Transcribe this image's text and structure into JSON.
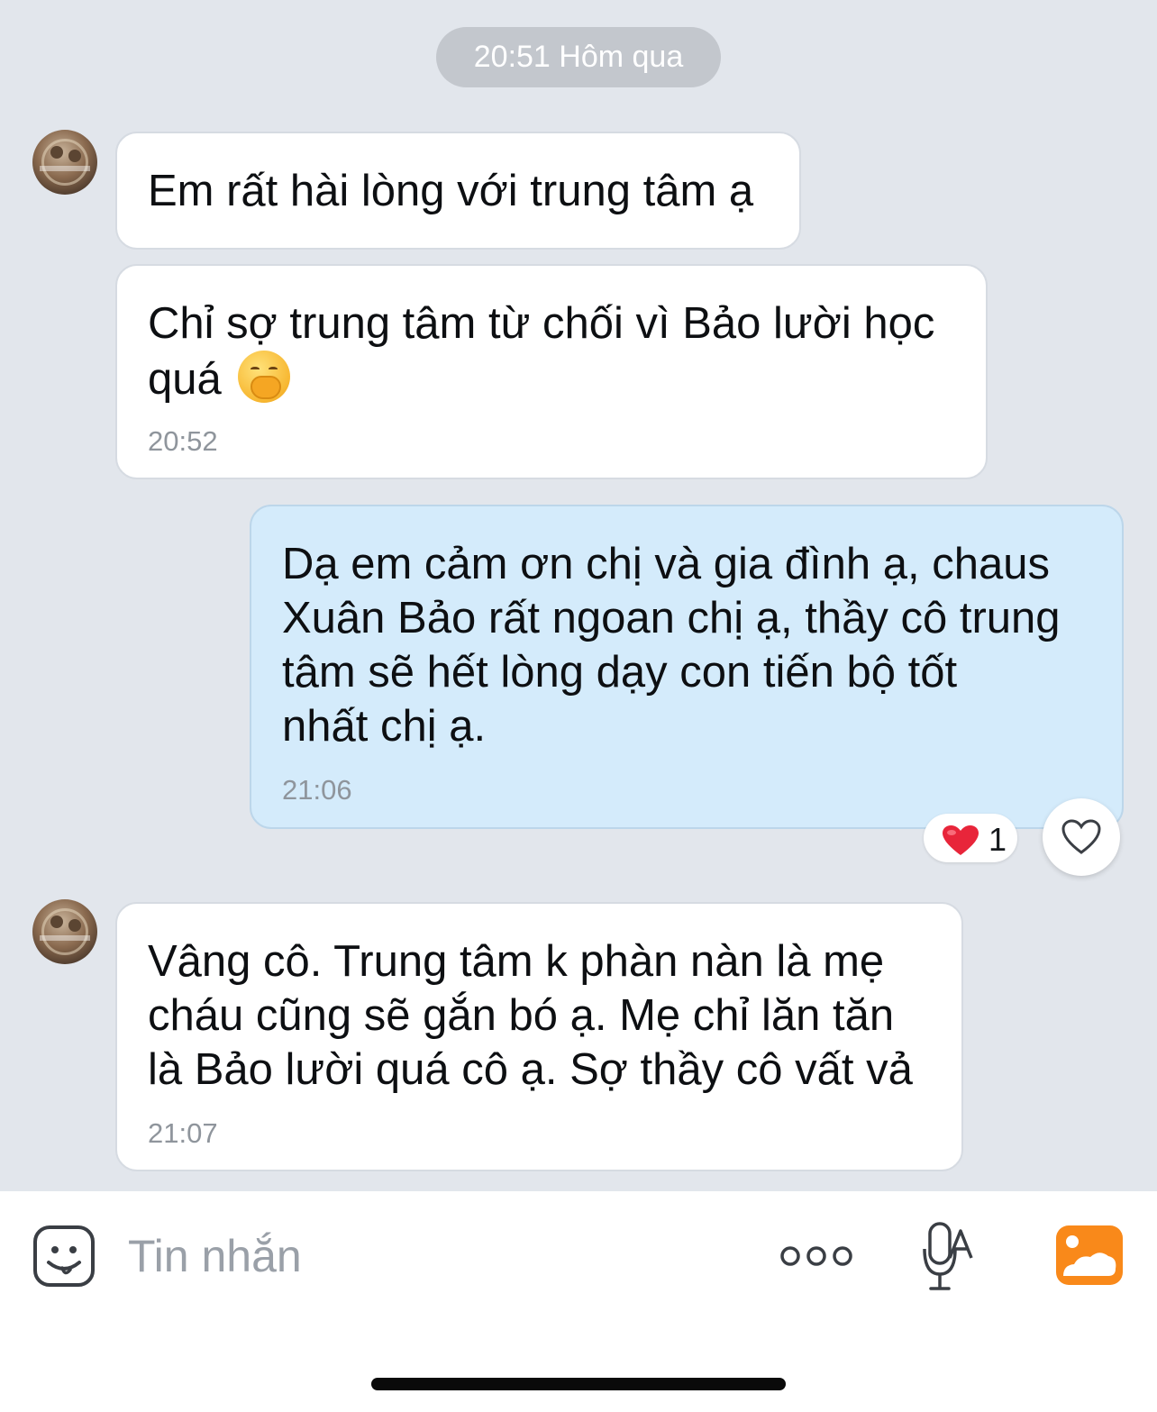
{
  "date_separator": "20:51 Hôm qua",
  "messages": [
    {
      "direction": "incoming",
      "lines": [
        "Em rất hài lòng với trung tâm ạ"
      ],
      "time": ""
    },
    {
      "direction": "incoming",
      "lines": [
        "Chỉ sợ trung tâm từ chối vì Bảo lười học",
        "quá"
      ],
      "emoji": "face-with-hand-over-mouth-emoji",
      "time": "20:52"
    },
    {
      "direction": "outgoing",
      "lines": [
        "Dạ em cảm ơn chị và gia đình ạ, chaus",
        "Xuân Bảo rất ngoan chị ạ, thầy cô trung",
        "tâm sẽ hết lòng dạy con tiến bộ tốt",
        "nhất chị ạ."
      ],
      "time": "21:06",
      "reaction": {
        "icon": "red-heart-icon",
        "count": "1"
      }
    },
    {
      "direction": "incoming",
      "lines": [
        "Vâng cô. Trung tâm k phàn nàn là mẹ",
        "cháu cũng sẽ gắn bó ạ. Mẹ chỉ lăn tăn",
        "là Bảo lười quá cô ạ. Sợ thầy cô vất vả"
      ],
      "time": "21:07"
    }
  ],
  "composer": {
    "placeholder": "Tin nhắn",
    "icons": [
      "sticker-icon",
      "more-icon",
      "voice-to-text-icon",
      "image-icon"
    ]
  },
  "colors": {
    "chat_background": "#e2e6ec",
    "incoming_bubble": "#ffffff",
    "outgoing_bubble": "#d4ebfb",
    "timestamp": "#8f959c",
    "image_button": "#f9891a",
    "heart": "#e8253a"
  }
}
